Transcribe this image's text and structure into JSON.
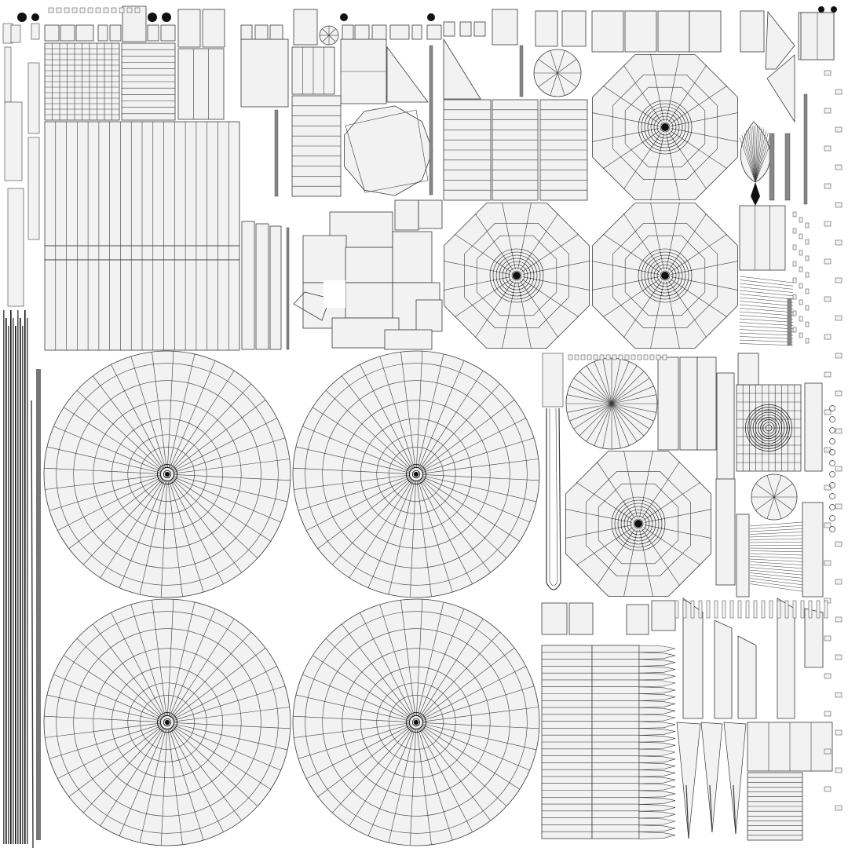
{
  "uv_layout": {
    "colors": {
      "background": "#ffffff",
      "island_fill": "#f2f2f2",
      "wire": "#3a3a3a",
      "solid": "#111111"
    },
    "disc_islands": {
      "radial_segments": 36,
      "ring_count": 6
    },
    "polygon_islands": {
      "sides": 8,
      "radial_segments": 16,
      "ring_count": 8
    },
    "strip_islands": {
      "long_strips": 14
    }
  }
}
